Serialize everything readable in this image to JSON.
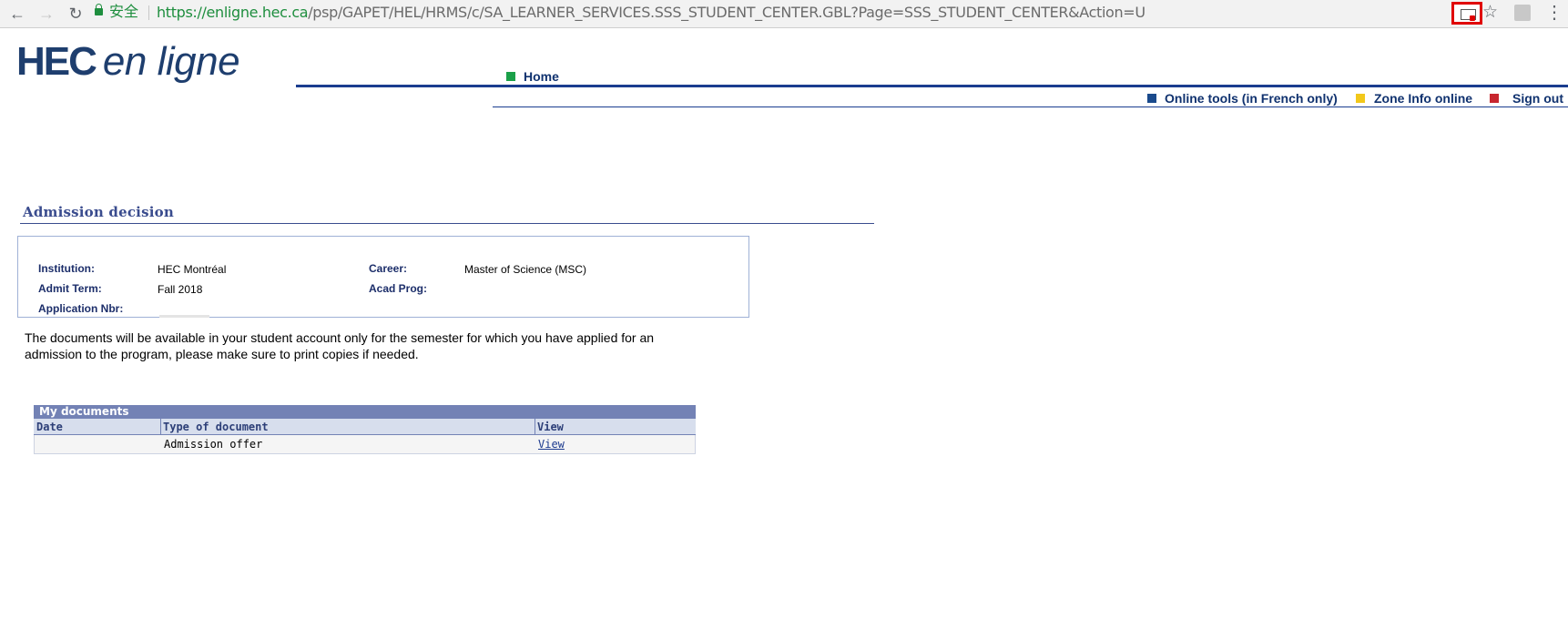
{
  "browser": {
    "secure_label": "安全",
    "url_host": "https://enligne.hec.ca",
    "url_path": "/psp/GAPET/HEL/HRMS/c/SA_LEARNER_SERVICES.SSS_STUDENT_CENTER.GBL?Page=SSS_STUDENT_CENTER&Action=U",
    "back_icon": "←",
    "forward_icon": "→",
    "reload_icon": "↻",
    "star_icon": "☆",
    "menu_icon": "⋮"
  },
  "header": {
    "logo_hec": "HEC",
    "logo_rest": "en ligne",
    "home_label": "Home",
    "tools": [
      {
        "label": "Online tools (in French only)",
        "color": "#1a4a8c"
      },
      {
        "label": "Zone Info online",
        "color": "#f2c81b"
      },
      {
        "label": "Sign out",
        "color": "#c8262f"
      }
    ],
    "home_color": "#1ba049"
  },
  "page": {
    "title": "Admission decision",
    "fields": {
      "institution_label": "Institution:",
      "institution_value": "HEC Montréal",
      "career_label": "Career:",
      "career_value": "Master of Science (MSC)",
      "admit_term_label": "Admit Term:",
      "admit_term_value": "Fall 2018",
      "acad_prog_label": "Acad Prog:",
      "acad_prog_value": "",
      "application_nbr_label": "Application Nbr:"
    },
    "notice": "The documents will be available in your student account only for the semester for which you have applied for an admission to the program, please make sure to print copies if needed."
  },
  "documents": {
    "title": "My documents",
    "columns": [
      "Date",
      "Type of document",
      "View"
    ],
    "rows": [
      {
        "date": "",
        "type": "Admission offer",
        "view": "View"
      }
    ]
  }
}
